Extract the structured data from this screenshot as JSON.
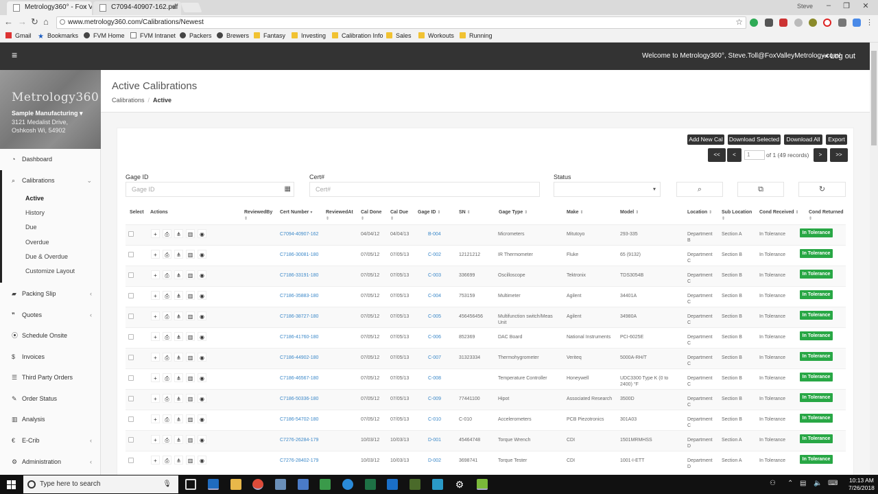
{
  "browser": {
    "tabs": [
      {
        "title": "Metrology360° - Fox Valle"
      },
      {
        "title": "C7094-40907-162.pdf"
      }
    ],
    "window_user": "Steve",
    "url": "www.metrology360.com/Calibrations/Newest",
    "bookmarks": [
      "Gmail",
      "Bookmarks",
      "FVM Home",
      "FVM Intranet",
      "Packers",
      "Brewers",
      "Fantasy",
      "Investing",
      "Calibration Info",
      "Sales",
      "Workouts",
      "Running"
    ]
  },
  "header": {
    "menu_icon": "≡",
    "welcome": "Welcome to Metrology360°, Steve.Toll@FoxValleyMetrology.com!",
    "logout": "Log out"
  },
  "sidebar": {
    "logo": "Metrology360",
    "company": "Sample Manufacturing ▾",
    "address1": "3121 Medalist Drive,",
    "address2": "Oshkosh Wi, 54902",
    "items": [
      {
        "label": "Dashboard",
        "icon": "dashboard-icon"
      },
      {
        "label": "Calibrations",
        "icon": "search-icon"
      },
      {
        "label": "Packing Slip",
        "icon": "truck-icon"
      },
      {
        "label": "Quotes",
        "icon": "quote-icon"
      },
      {
        "label": "Schedule Onsite",
        "icon": "map-marker-icon"
      },
      {
        "label": "Invoices",
        "icon": "dollar-icon"
      },
      {
        "label": "Third Party Orders",
        "icon": "list-icon"
      },
      {
        "label": "Order Status",
        "icon": "wrench-icon"
      },
      {
        "label": "Analysis",
        "icon": "bar-chart-icon"
      },
      {
        "label": "E-Crib",
        "icon": "dollar-circle-icon"
      },
      {
        "label": "Administration",
        "icon": "gear-icon"
      }
    ],
    "calibration_subitems": [
      "Active",
      "History",
      "Due",
      "Overdue",
      "Due & Overdue",
      "Customize Layout"
    ]
  },
  "page": {
    "title": "Active Calibrations",
    "breadcrumb": [
      "Calibrations",
      "Active"
    ]
  },
  "toolbar": {
    "add_new": "Add New Cal",
    "download_selected": "Download Selected",
    "download_all": "Download All",
    "export": "Export",
    "first": "<<",
    "prev": "<",
    "next": ">",
    "last": ">>",
    "page_value": "1",
    "page_info": "of 1 (49 records)"
  },
  "filters": {
    "gage_id_label": "Gage ID",
    "gage_id_placeholder": "Gage ID",
    "cert_label": "Cert#",
    "cert_placeholder": "Cert#",
    "status_label": "Status",
    "status_value": ""
  },
  "table": {
    "headers": {
      "select": "Select",
      "actions": "Actions",
      "reviewed_by": "ReviewedBy",
      "cert_number": "Cert Number",
      "reviewed_at": "ReviewedAt",
      "cal_done": "Cal Done",
      "cal_due": "Cal Due",
      "gage_id": "Gage ID",
      "sn": "SN",
      "gage_type": "Gage Type",
      "make": "Make",
      "model": "Model",
      "location": "Location",
      "sub_location": "Sub Location",
      "cond_received": "Cond Received",
      "cond_returned": "Cond Returned"
    },
    "rows": [
      {
        "cert": "C7094-40907-162",
        "done": "04/04/12",
        "due": "04/04/13",
        "gage": "B-004",
        "sn": "",
        "type": "Micrometers",
        "make": "Mitutoyo",
        "model": "293-335",
        "loc": "Department B",
        "sub": "Section A",
        "recv": "In Tolerance",
        "ret": "In Tolerance"
      },
      {
        "cert": "C7186-30081-180",
        "done": "07/05/12",
        "due": "07/05/13",
        "gage": "C-002",
        "sn": "12121212",
        "type": "IR Thermometer",
        "make": "Fluke",
        "model": "65 (9132)",
        "loc": "Department C",
        "sub": "Section B",
        "recv": "In Tolerance",
        "ret": "In Tolerance"
      },
      {
        "cert": "C7186-33191-180",
        "done": "07/05/12",
        "due": "07/05/13",
        "gage": "C-003",
        "sn": "336699",
        "type": "Oscilloscope",
        "make": "Tektronix",
        "model": "TDS3054B",
        "loc": "Department C",
        "sub": "Section B",
        "recv": "In Tolerance",
        "ret": "In Tolerance"
      },
      {
        "cert": "C7186-35883-180",
        "done": "07/05/12",
        "due": "07/05/13",
        "gage": "C-004",
        "sn": "753159",
        "type": "Multimeter",
        "make": "Agilent",
        "model": "34401A",
        "loc": "Department C",
        "sub": "Section B",
        "recv": "In Tolerance",
        "ret": "In Tolerance"
      },
      {
        "cert": "C7186-38727-180",
        "done": "07/05/12",
        "due": "07/05/13",
        "gage": "C-005",
        "sn": "456456456",
        "type": "Multifunction switch/Meas Unit",
        "make": "Agilent",
        "model": "34980A",
        "loc": "Department C",
        "sub": "Section B",
        "recv": "In Tolerance",
        "ret": "In Tolerance"
      },
      {
        "cert": "C7186-41760-180",
        "done": "07/05/12",
        "due": "07/05/13",
        "gage": "C-006",
        "sn": "852369",
        "type": "DAC Board",
        "make": "National Instruments",
        "model": "PCI-6025E",
        "loc": "Department C",
        "sub": "Section B",
        "recv": "In Tolerance",
        "ret": "In Tolerance"
      },
      {
        "cert": "C7186-44902-180",
        "done": "07/05/12",
        "due": "07/05/13",
        "gage": "C-007",
        "sn": "31323334",
        "type": "Thermohygrometer",
        "make": "Veriteq",
        "model": "5000A-RH/T",
        "loc": "Department C",
        "sub": "Section B",
        "recv": "In Tolerance",
        "ret": "In Tolerance"
      },
      {
        "cert": "C7186-46567-180",
        "done": "07/05/12",
        "due": "07/05/13",
        "gage": "C-008",
        "sn": "",
        "type": "Temperature Controller",
        "make": "Honeywell",
        "model": "UDC3300 Type K (0 to 2400) °F",
        "loc": "Department C",
        "sub": "Section B",
        "recv": "In Tolerance",
        "ret": "In Tolerance"
      },
      {
        "cert": "C7186-50336-180",
        "done": "07/05/12",
        "due": "07/05/13",
        "gage": "C-009",
        "sn": "77441100",
        "type": "Hipot",
        "make": "Associated Research",
        "model": "3500D",
        "loc": "Department C",
        "sub": "Section B",
        "recv": "In Tolerance",
        "ret": "In Tolerance"
      },
      {
        "cert": "C7186-54702-180",
        "done": "07/05/12",
        "due": "07/05/13",
        "gage": "C-010",
        "sn": "C-010",
        "type": "Accelerometers",
        "make": "PCB Piezotronics",
        "model": "301A03",
        "loc": "Department C",
        "sub": "Section B",
        "recv": "In Tolerance",
        "ret": "In Tolerance"
      },
      {
        "cert": "C7276-26284-179",
        "done": "10/03/12",
        "due": "10/03/13",
        "gage": "D-001",
        "sn": "45464748",
        "type": "Torque Wrench",
        "make": "CDI",
        "model": "1501MRMHSS",
        "loc": "Department D",
        "sub": "Section A",
        "recv": "In Tolerance",
        "ret": "In Tolerance"
      },
      {
        "cert": "C7276-28402-179",
        "done": "10/03/12",
        "due": "10/03/13",
        "gage": "D-002",
        "sn": "3698741",
        "type": "Torque Tester",
        "make": "CDI",
        "model": "1001-I-ETT",
        "loc": "Department D",
        "sub": "Section A",
        "recv": "In Tolerance",
        "ret": "In Tolerance"
      }
    ]
  },
  "taskbar": {
    "search_placeholder": "Type here to search",
    "time": "10:13 AM",
    "date": "7/26/2018"
  },
  "colors": {
    "header_bg": "#333333",
    "badge_green": "#28a745",
    "link_blue": "#3a87c8"
  }
}
